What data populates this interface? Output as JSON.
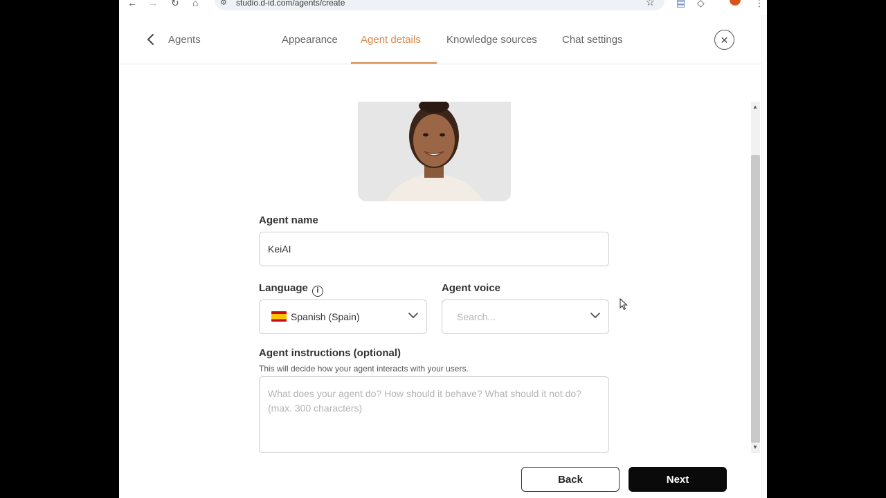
{
  "browser": {
    "url": "studio.d-id.com/agents/create"
  },
  "nav": {
    "back_label": "Agents",
    "tabs": [
      {
        "label": "Appearance",
        "active": false
      },
      {
        "label": "Agent details",
        "active": true
      },
      {
        "label": "Knowledge sources",
        "active": false
      },
      {
        "label": "Chat settings",
        "active": false
      }
    ]
  },
  "form": {
    "agent_name": {
      "label": "Agent name",
      "value": "KeiAI"
    },
    "language": {
      "label": "Language",
      "value": "Spanish (Spain)",
      "flag": "spain-flag"
    },
    "agent_voice": {
      "label": "Agent voice",
      "placeholder": "Search..."
    },
    "instructions": {
      "label": "Agent instructions (optional)",
      "helper": "This will decide how your agent interacts with your users.",
      "placeholder": "What does your agent do? How should it behave? What should it not do? (max. 300 characters)"
    }
  },
  "actions": {
    "back_label": "Back",
    "next_label": "Next"
  },
  "colors": {
    "accent": "#d8894c",
    "primary_button": "#0a0a0a"
  }
}
